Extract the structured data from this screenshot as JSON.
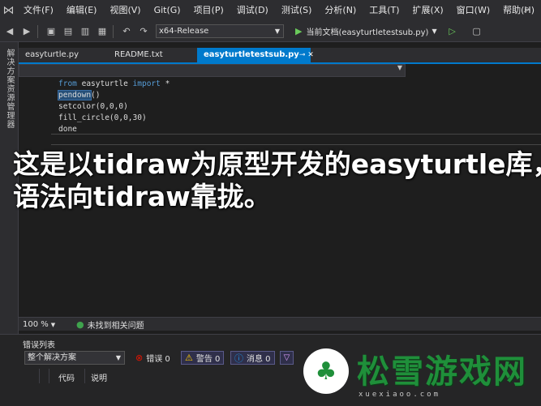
{
  "menubar": {
    "items": [
      "文件(F)",
      "编辑(E)",
      "视图(V)",
      "Git(G)",
      "项目(P)",
      "调试(D)",
      "测试(S)",
      "分析(N)",
      "工具(T)",
      "扩展(X)",
      "窗口(W)",
      "帮助(H)"
    ]
  },
  "toolbar": {
    "configuration": "x64-Release",
    "run_label": "当前文档(easyturtletestsub.py)"
  },
  "side_panel": {
    "label": "解决方案资源管理器"
  },
  "tabs": [
    {
      "label": "easyturtle.py"
    },
    {
      "label": "README.txt"
    },
    {
      "label": "easyturtletestsub.py",
      "active": true
    }
  ],
  "editor": {
    "lines": [
      {
        "kw1": "from",
        "mid": " easyturtle ",
        "kw2": "import",
        "rest": " *"
      },
      {
        "sel": "pendown",
        "rest": "()"
      },
      {
        "text": "setcolor(0,0,0)"
      },
      {
        "text": "fill_circle(0,0,30)"
      },
      {
        "text": "done"
      }
    ]
  },
  "subtitle": {
    "line1": "这是以tidraw为原型开发的easyturtle库，",
    "line2": "语法向tidraw靠拢。"
  },
  "status": {
    "zoom": "100 %",
    "issues": "未找到相关问题"
  },
  "error_list": {
    "title": "错误列表",
    "scope": "整个解决方案",
    "errors": "错误 0",
    "warnings": "警告 0",
    "messages": "消息 0",
    "columns": [
      "代码",
      "说明"
    ]
  },
  "watermark": {
    "title": "松雪游戏网",
    "url": "xuexiaoo.com"
  }
}
